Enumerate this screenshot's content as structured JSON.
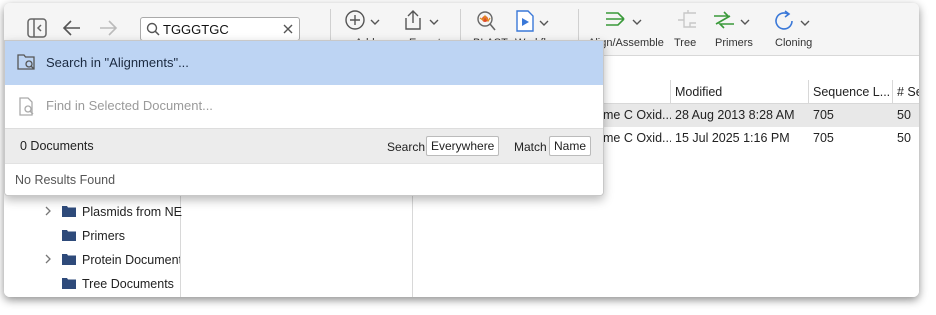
{
  "search": {
    "query": "TGGGTGC"
  },
  "toolbar": {
    "add_label": "Add",
    "export_label": "Export",
    "blast_label": "BLAST",
    "workflows_label": "Workflows",
    "align_label": "Align/Assemble",
    "tree_label": "Tree",
    "primers_label": "Primers",
    "cloning_label": "Cloning"
  },
  "popup": {
    "option_search_in": "Search in \"Alignments\"...",
    "option_find_in": "Find in Selected Document...",
    "documents_count": "0 Documents",
    "search_label": "Search",
    "search_scope": "Everywhere",
    "match_label": "Match",
    "match_field": "Name",
    "no_results": "No Results Found"
  },
  "tree": {
    "items": [
      {
        "label": "Plasmids from NE",
        "has_children": true
      },
      {
        "label": "Primers",
        "has_children": false
      },
      {
        "label": "Protein Document",
        "has_children": true
      },
      {
        "label": "Tree Documents",
        "has_children": false
      }
    ]
  },
  "table": {
    "columns": [
      "Modified",
      "Sequence L...",
      "# Se"
    ],
    "rows": [
      {
        "name": "me C Oxid...",
        "modified": "28 Aug 2013 8:28 AM",
        "length": "705",
        "seqs": "50"
      },
      {
        "name": "me C Oxid...",
        "modified": "15 Jul 2025 1:16 PM",
        "length": "705",
        "seqs": "50"
      }
    ]
  },
  "colors": {
    "selection_blue": "#bdd4f3",
    "toolbar_bg": "#f5f5f5",
    "icon_blue": "#3a78d8",
    "icon_green": "#3a9a3a",
    "folder_navy": "#2e4a7a"
  }
}
